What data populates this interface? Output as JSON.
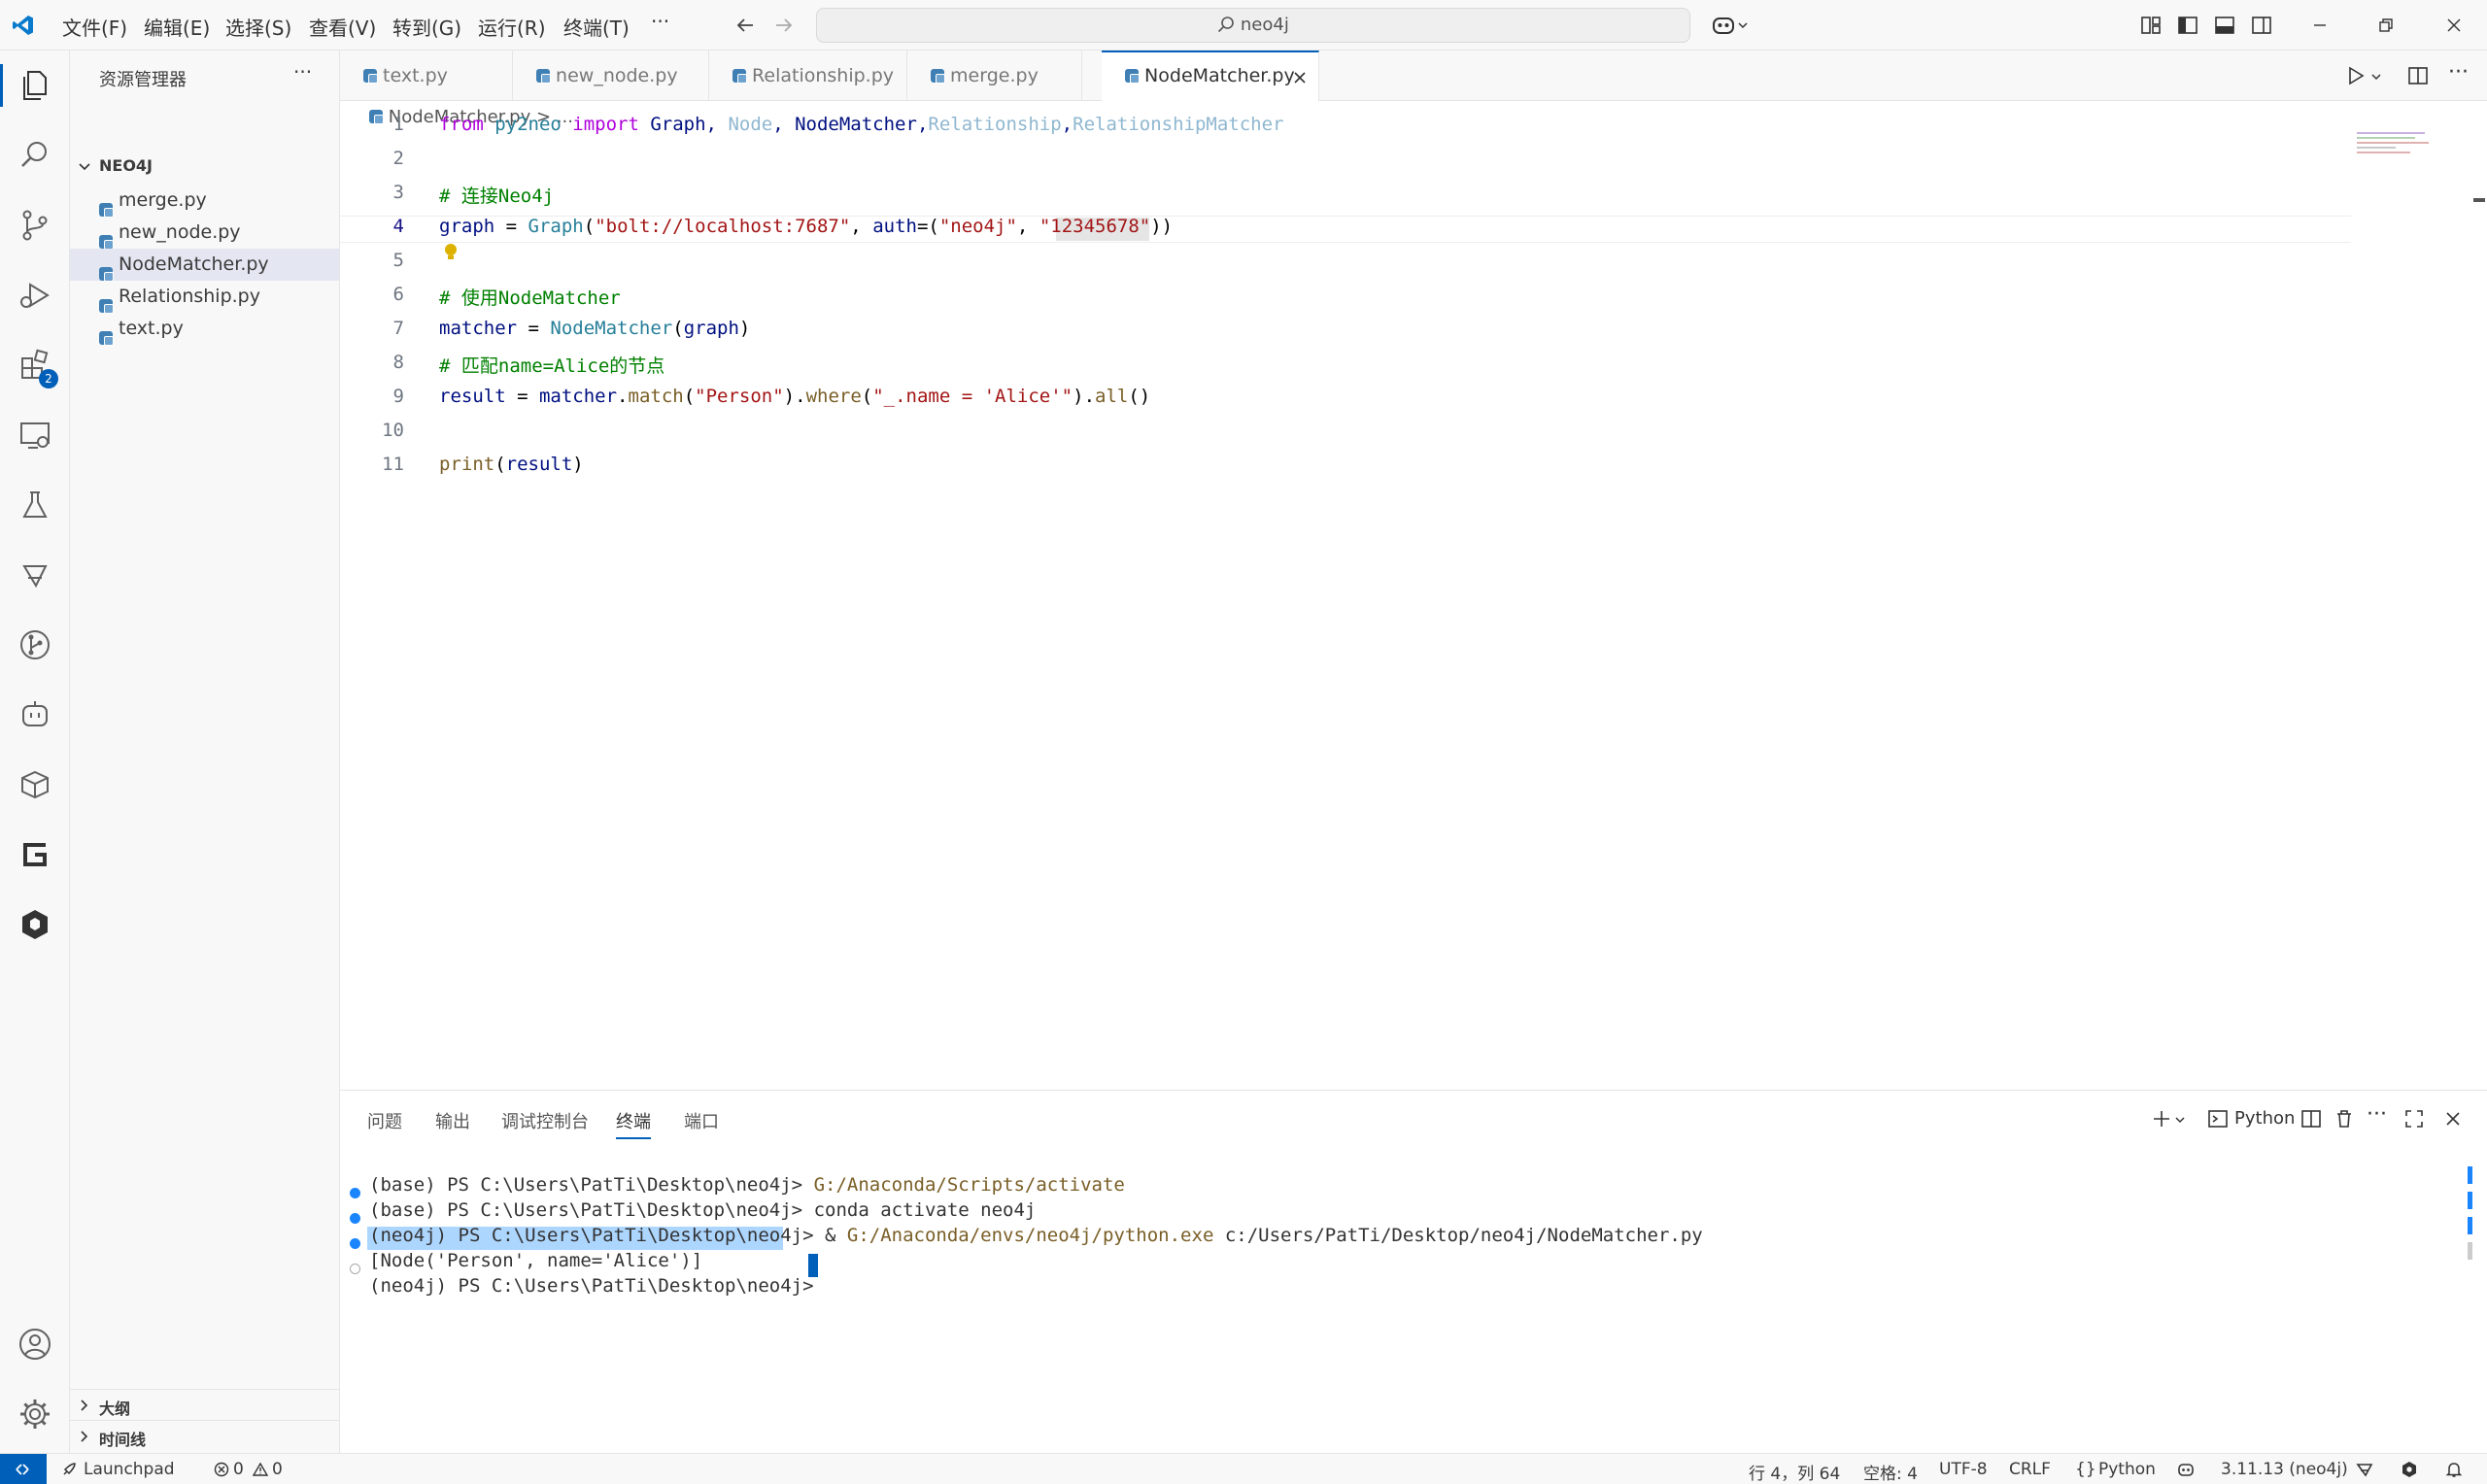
{
  "menu": [
    "文件(F)",
    "编辑(E)",
    "选择(S)",
    "查看(V)",
    "转到(G)",
    "运行(R)",
    "终端(T)",
    "···"
  ],
  "search": "neo4j",
  "sidebar": {
    "title": "资源管理器",
    "more": "···",
    "folder": "NEO4J",
    "files": [
      "merge.py",
      "new_node.py",
      "NodeMatcher.py",
      "Relationship.py",
      "text.py"
    ],
    "outline": "大纲",
    "timeline": "时间线"
  },
  "activity_badge": "2",
  "tabs": [
    "text.py",
    "new_node.py",
    "Relationship.py",
    "merge.py",
    "NodeMatcher.py"
  ],
  "breadcrumb": {
    "file": "NodeMatcher.py",
    "rest": "..."
  },
  "editor": {
    "line_numbers": [
      "1",
      "2",
      "3",
      "4",
      "5",
      "6",
      "7",
      "8",
      "9",
      "10",
      "11"
    ],
    "lines": [
      [
        {
          "t": "from",
          "c": "kw"
        },
        {
          "t": " py2neo ",
          "c": "mod"
        },
        {
          "t": "import",
          "c": "kw"
        },
        {
          "t": " Graph, ",
          "c": "var"
        },
        {
          "t": "Node",
          "c": "dim"
        },
        {
          "t": ", ",
          "c": "var"
        },
        {
          "t": "NodeMatcher",
          "c": "var"
        },
        {
          "t": ",",
          "c": "var"
        },
        {
          "t": "Relationship",
          "c": "dim"
        },
        {
          "t": ",",
          "c": "var"
        },
        {
          "t": "RelationshipMatcher",
          "c": "dim"
        }
      ],
      [],
      [
        {
          "t": "# 连接Neo4j",
          "c": "cm"
        }
      ],
      [
        {
          "t": "graph",
          "c": "var"
        },
        {
          "t": " = ",
          "c": "op"
        },
        {
          "t": "Graph",
          "c": "cls"
        },
        {
          "t": "(",
          "c": "op"
        },
        {
          "t": "\"bolt://localhost:7687\"",
          "c": "str"
        },
        {
          "t": ", ",
          "c": "op"
        },
        {
          "t": "auth",
          "c": "var"
        },
        {
          "t": "=(",
          "c": "op"
        },
        {
          "t": "\"neo4j\"",
          "c": "str"
        },
        {
          "t": ", ",
          "c": "op"
        },
        {
          "t": "\"12345678\"",
          "c": "str"
        },
        {
          "t": "))",
          "c": "op"
        }
      ],
      [],
      [
        {
          "t": "# 使用NodeMatcher",
          "c": "cm"
        }
      ],
      [
        {
          "t": "matcher",
          "c": "var"
        },
        {
          "t": " = ",
          "c": "op"
        },
        {
          "t": "NodeMatcher",
          "c": "cls"
        },
        {
          "t": "(",
          "c": "op"
        },
        {
          "t": "graph",
          "c": "var"
        },
        {
          "t": ")",
          "c": "op"
        }
      ],
      [
        {
          "t": "# 匹配name=Alice的节点",
          "c": "cm"
        }
      ],
      [
        {
          "t": "result",
          "c": "var"
        },
        {
          "t": " = ",
          "c": "op"
        },
        {
          "t": "matcher",
          "c": "var"
        },
        {
          "t": ".",
          "c": "op"
        },
        {
          "t": "match",
          "c": "fn"
        },
        {
          "t": "(",
          "c": "op"
        },
        {
          "t": "\"Person\"",
          "c": "str"
        },
        {
          "t": ").",
          "c": "op"
        },
        {
          "t": "where",
          "c": "fn"
        },
        {
          "t": "(",
          "c": "op"
        },
        {
          "t": "\"_.name = 'Alice'\"",
          "c": "str"
        },
        {
          "t": ").",
          "c": "op"
        },
        {
          "t": "all",
          "c": "fn"
        },
        {
          "t": "()",
          "c": "op"
        }
      ],
      [],
      [
        {
          "t": "print",
          "c": "fn"
        },
        {
          "t": "(",
          "c": "op"
        },
        {
          "t": "result",
          "c": "var"
        },
        {
          "t": ")",
          "c": "op"
        }
      ]
    ]
  },
  "panel": {
    "tabs": [
      "问题",
      "输出",
      "调试控制台",
      "终端",
      "端口"
    ],
    "shell": "Python",
    "terminal": [
      [
        {
          "t": "(base) PS C:\\Users\\PatTi\\Desktop\\neo4j> ",
          "c": "t"
        },
        {
          "t": "G:/Anaconda/Scripts/activate",
          "c": "tf"
        }
      ],
      [
        {
          "t": "(base) PS C:\\Users\\PatTi\\Desktop\\neo4j> ",
          "c": "t"
        },
        {
          "t": "conda activate neo4j",
          "c": "t"
        }
      ],
      [
        {
          "t": "(neo4j) PS C:\\Users\\PatTi\\Desktop\\neo4j> ",
          "c": "t"
        },
        {
          "t": "& ",
          "c": "t"
        },
        {
          "t": "G:/Anaconda/envs/neo4j/python.exe",
          "c": "tf"
        },
        {
          "t": " c:/Users/PatTi/Desktop/neo4j/NodeMatcher.py",
          "c": "t"
        }
      ],
      [
        {
          "t": "[Node('Person', name='Alice')]",
          "c": "sel"
        }
      ],
      [
        {
          "t": "(neo4j) PS C:\\Users\\PatTi\\Desktop\\neo4j> ",
          "c": "t"
        }
      ]
    ]
  },
  "status": {
    "launchpad": "Launchpad",
    "errors": "0",
    "warnings": "0",
    "position": "行 4，列 64",
    "spaces": "空格: 4",
    "encoding": "UTF-8",
    "eol": "CRLF",
    "language": "Python",
    "interpreter": "3.11.13 (neo4j)"
  },
  "colors": {
    "kw": "#af00db",
    "mod": "#267f99",
    "var": "#001080",
    "dim": "#8fb7d0",
    "cm": "#008000",
    "cls": "#267f99",
    "str": "#a31515",
    "op": "#000000",
    "fn": "#795e26",
    "t": "#333333",
    "tf": "#795e26",
    "sel": "#333333",
    "accent": "#005fb8",
    "dot": "#1a85ff"
  }
}
